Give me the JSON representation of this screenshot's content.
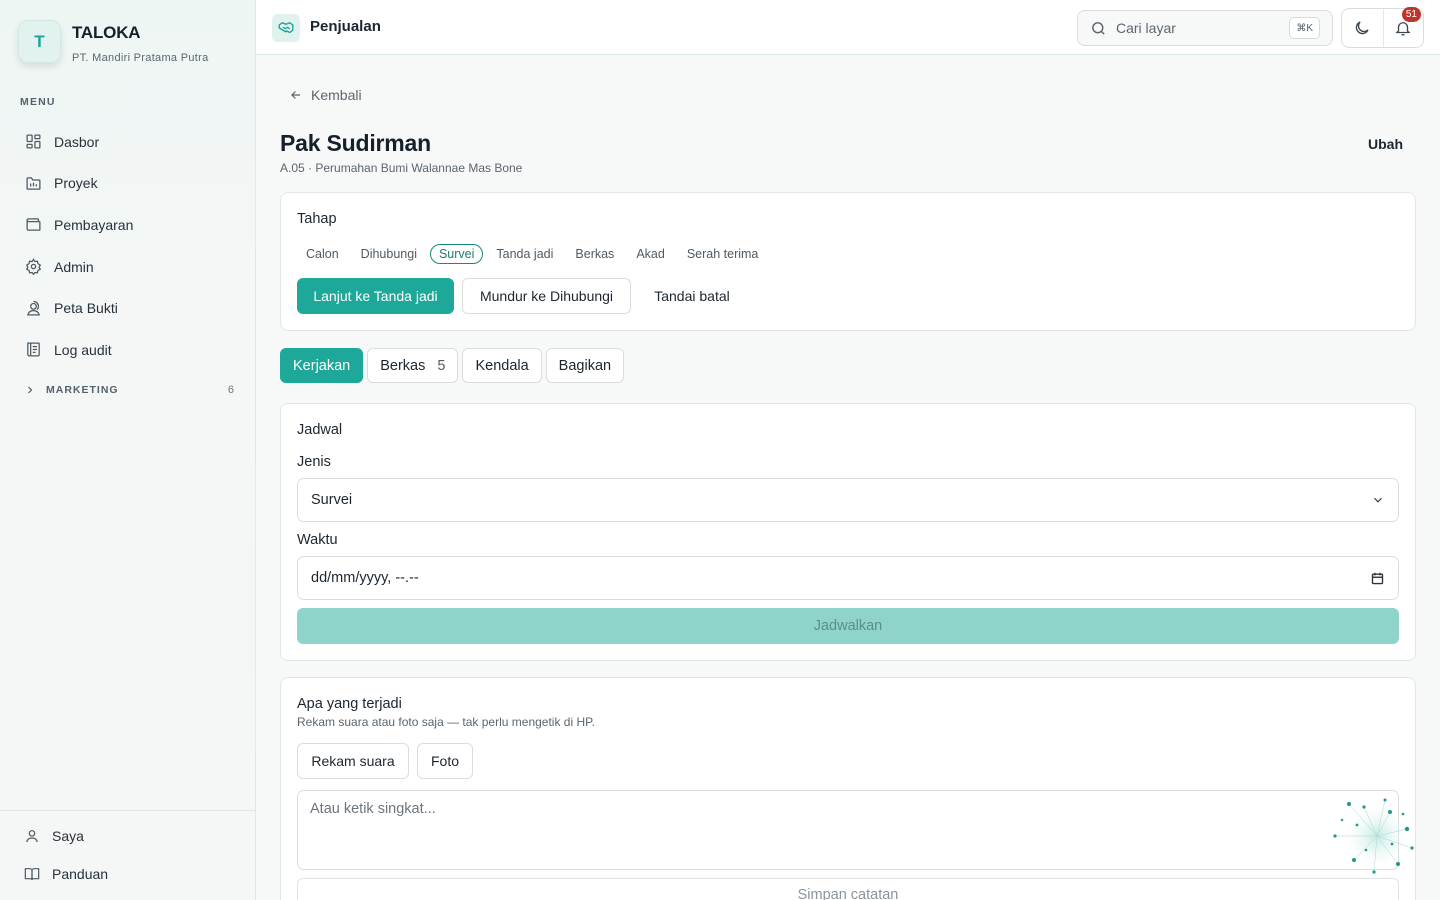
{
  "brand": {
    "logo_letter": "T",
    "name": "TALOKA",
    "company": "PT. Mandiri Pratama Putra"
  },
  "sidebar": {
    "menu_heading": "MENU",
    "items": [
      {
        "label": "Dasbor",
        "icon": "dashboard-icon"
      },
      {
        "label": "Proyek",
        "icon": "folder-icon"
      },
      {
        "label": "Pembayaran",
        "icon": "wallet-icon"
      },
      {
        "label": "Admin",
        "icon": "gear-icon"
      },
      {
        "label": "Peta Bukti",
        "icon": "map-pin-user-icon"
      },
      {
        "label": "Log audit",
        "icon": "log-icon"
      }
    ],
    "marketing": {
      "label": "MARKETING",
      "count": "6"
    },
    "footer": [
      {
        "label": "Saya",
        "icon": "user-icon"
      },
      {
        "label": "Panduan",
        "icon": "book-icon"
      }
    ]
  },
  "topbar": {
    "title": "Penjualan",
    "search_placeholder": "Cari layar",
    "search_shortcut": "⌘K",
    "notification_count": "51"
  },
  "page": {
    "back_label": "Kembali",
    "title": "Pak Sudirman",
    "subtitle": "A.05 · Perumahan Bumi Walannae Mas Bone",
    "edit_label": "Ubah"
  },
  "stage_card": {
    "title": "Tahap",
    "stages": [
      "Calon",
      "Dihubungi",
      "Survei",
      "Tanda jadi",
      "Berkas",
      "Akad",
      "Serah terima"
    ],
    "active_stage": "Survei",
    "next_label": "Lanjut ke Tanda jadi",
    "prev_label": "Mundur ke Dihubungi",
    "cancel_label": "Tandai batal"
  },
  "tabs": [
    {
      "label": "Kerjakan",
      "count": "",
      "active": true
    },
    {
      "label": "Berkas",
      "count": "5",
      "active": false
    },
    {
      "label": "Kendala",
      "count": "",
      "active": false
    },
    {
      "label": "Bagikan",
      "count": "",
      "active": false
    }
  ],
  "schedule_card": {
    "title": "Jadwal",
    "type_label": "Jenis",
    "type_value": "Survei",
    "time_label": "Waktu",
    "time_value": "dd/mm/yyyy, --.--",
    "submit_label": "Jadwalkan"
  },
  "note_card": {
    "title": "Apa yang terjadi",
    "description": "Rekam suara atau foto saja — tak perlu mengetik di HP.",
    "voice_label": "Rekam suara",
    "photo_label": "Foto",
    "text_placeholder": "Atau ketik singkat...",
    "save_label": "Simpan catatan"
  },
  "colors": {
    "accent": "#1ea899",
    "accent_disabled": "#8fd4cb",
    "badge": "#c0352b"
  }
}
